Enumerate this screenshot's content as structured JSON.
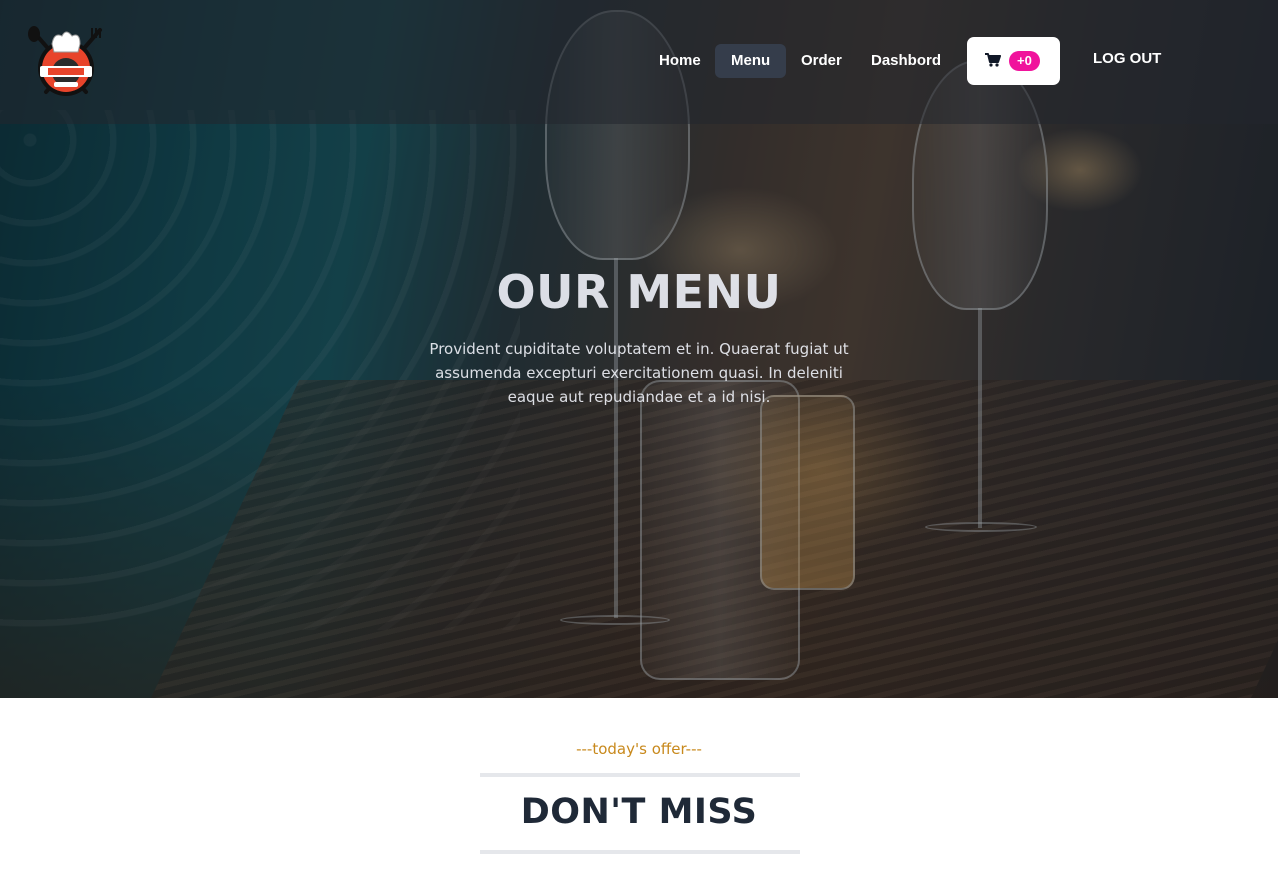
{
  "nav": {
    "logo_alt": "restaurant logo",
    "links": [
      {
        "label": "Home"
      },
      {
        "label": "Menu",
        "active": true
      },
      {
        "label": "Order"
      },
      {
        "label": "Dashbord"
      }
    ],
    "cart": {
      "icon": "cart-icon",
      "count": "+0"
    },
    "logout_label": "LOG OUT"
  },
  "hero": {
    "title": "OUR MENU",
    "text": "Provident cupiditate voluptatem et in. Quaerat fugiat ut assumenda excepturi exercitationem quasi. In deleniti eaque aut repudiandae et a id nisi."
  },
  "section": {
    "subheading": "---today's offer---",
    "heading": "DON'T MISS"
  },
  "colors": {
    "accent_badge": "#f0139c",
    "subheading": "#c8891c",
    "heading": "#1f2937"
  }
}
